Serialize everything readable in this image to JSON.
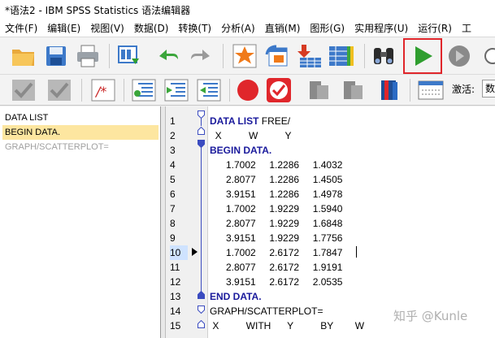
{
  "window": {
    "title": "*语法2 - IBM SPSS Statistics 语法编辑器"
  },
  "menu": [
    "文件(F)",
    "编辑(E)",
    "视图(V)",
    "数据(D)",
    "转换(T)",
    "分析(A)",
    "直销(M)",
    "图形(G)",
    "实用程序(U)",
    "运行(R)",
    "工"
  ],
  "toolbar": {
    "activate_label": "激活:",
    "activate_value": "数"
  },
  "navigator": {
    "items": [
      "DATA LIST",
      "BEGIN DATA.",
      "GRAPH/SCATTERPLOT="
    ],
    "selected_index": 1
  },
  "editor": {
    "current_line": 10,
    "lines": [
      {
        "num": "1",
        "kw": "DATA LIST",
        "text": " FREE/"
      },
      {
        "num": "2",
        "kw": "",
        "text": "  X          W          Y"
      },
      {
        "num": "3",
        "kw": "BEGIN DATA.",
        "text": ""
      },
      {
        "num": "4",
        "kw": "",
        "text": "      1.7002     1.2286     1.4032"
      },
      {
        "num": "5",
        "kw": "",
        "text": "      2.8077     1.2286     1.4505"
      },
      {
        "num": "6",
        "kw": "",
        "text": "      3.9151     1.2286     1.4978"
      },
      {
        "num": "7",
        "kw": "",
        "text": "      1.7002     1.9229     1.5940"
      },
      {
        "num": "8",
        "kw": "",
        "text": "      2.8077     1.9229     1.6848"
      },
      {
        "num": "9",
        "kw": "",
        "text": "      3.9151     1.9229     1.7756"
      },
      {
        "num": "10",
        "kw": "",
        "text": "      1.7002     2.6172     1.7847"
      },
      {
        "num": "11",
        "kw": "",
        "text": "      2.8077     2.6172     1.9191"
      },
      {
        "num": "12",
        "kw": "",
        "text": "      3.9151     2.6172     2.0535"
      },
      {
        "num": "13",
        "kw": "END DATA.",
        "text": ""
      },
      {
        "num": "14",
        "kw": "",
        "text": "GRAPH/SCATTERPLOT="
      },
      {
        "num": "15",
        "kw": "",
        "text": " X          WITH      Y          BY        W"
      }
    ]
  },
  "watermark": "知乎 @Kunle",
  "colors": {
    "keyword": "#1a1a9c",
    "run_highlight": "#e0262b",
    "run_green": "#2f9e2f",
    "selection": "#fde6a0"
  }
}
